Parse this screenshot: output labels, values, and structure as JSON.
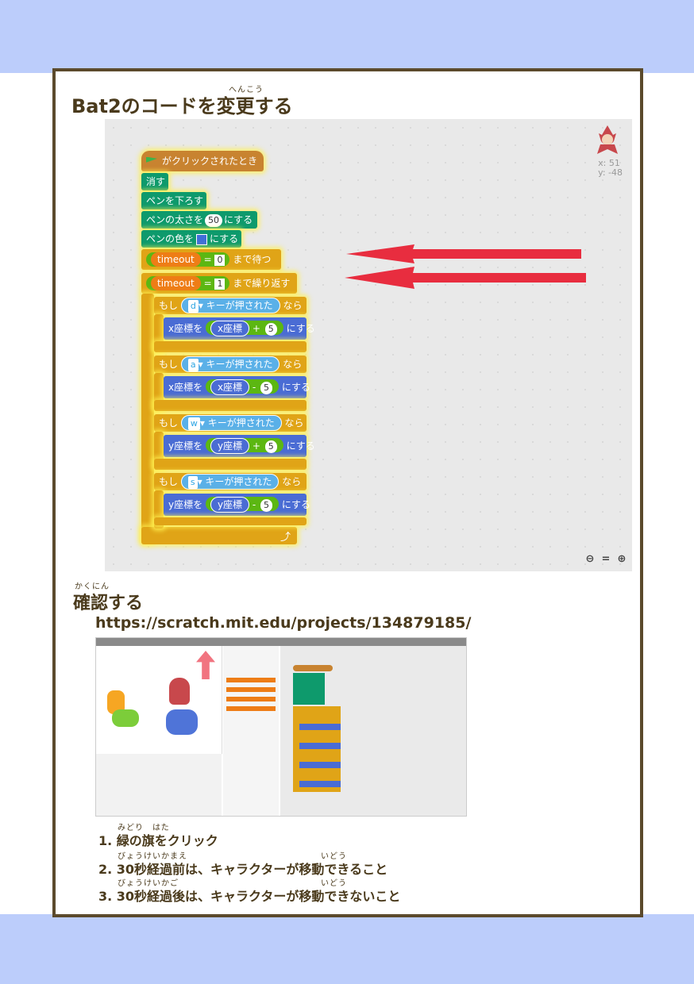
{
  "heading1": {
    "text": "Bat2のコードを変更する",
    "ruby": "へんこう"
  },
  "coords": {
    "x": "x: 51",
    "y": "y: -48"
  },
  "blocks": {
    "hat": "がクリックされたとき",
    "clear": "消す",
    "pen_down": "ペンを下ろす",
    "pen_size_pre": "ペンの太さを",
    "pen_size_val": "50",
    "pen_size_post": "にする",
    "pen_color_pre": "ペンの色を",
    "pen_color_post": "にする",
    "wait_var": "timeout",
    "wait_eq": "=",
    "wait_val": "0",
    "wait_post": "まで待つ",
    "repeat_var": "timeout",
    "repeat_eq": "=",
    "repeat_val": "1",
    "repeat_post": "まで繰り返す",
    "if_label": "もし",
    "then_label": "なら",
    "key_pressed": "キーが押された",
    "if_blocks": [
      {
        "key": "d",
        "axis": "x座標を",
        "reporter": "x座標",
        "op": "+",
        "val": "5",
        "post": "にする"
      },
      {
        "key": "a",
        "axis": "x座標を",
        "reporter": "x座標",
        "op": "-",
        "val": "5",
        "post": "にする"
      },
      {
        "key": "w",
        "axis": "y座標を",
        "reporter": "y座標",
        "op": "+",
        "val": "5",
        "post": "にする"
      },
      {
        "key": "s",
        "axis": "y座標を",
        "reporter": "y座標",
        "op": "-",
        "val": "5",
        "post": "にする"
      }
    ]
  },
  "heading2": {
    "text": "確認する",
    "ruby": "かくにん"
  },
  "url": "https://scratch.mit.edu/projects/134879185/",
  "steps": [
    {
      "text": "1. 緑の旗をクリック",
      "ruby": "みどり　はた"
    },
    {
      "text": "2. 30秒経過前は、キャラクターが移動できること",
      "ruby": "びょうけいかまえ",
      "ruby2": "いどう"
    },
    {
      "text": "3. 30秒経過後は、キャラクターが移動できないこと",
      "ruby": "びょうけいかご",
      "ruby2": "いどう"
    }
  ],
  "colors": {
    "band": "#bccdfb",
    "frame": "#5b4a2c",
    "arrow": "#e8182c"
  }
}
